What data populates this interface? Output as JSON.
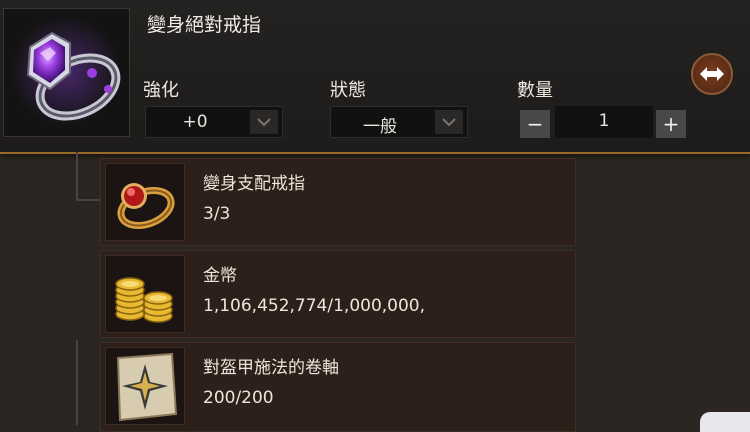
{
  "item": {
    "name": "變身絕對戒指",
    "icon": "purple-gem-ring-icon"
  },
  "controls": {
    "enhance": {
      "label": "強化",
      "value": "+0"
    },
    "status": {
      "label": "狀態",
      "value": "一般"
    },
    "quantity": {
      "label": "數量",
      "value": "1",
      "minus": "−",
      "plus": "+"
    }
  },
  "materials": [
    {
      "name": "變身支配戒指",
      "count": "3/3",
      "icon": "red-gem-ring-icon"
    },
    {
      "name": "金幣",
      "count": "1,106,452,774/1,000,000,",
      "icon": "gold-coins-icon"
    },
    {
      "name": "對盔甲施法的卷軸",
      "count": "200/200",
      "icon": "armor-scroll-icon"
    }
  ],
  "colors": {
    "accent_border": "#9a6a2a",
    "swap_button": "#6a3418",
    "material_bg": "#2d1f19"
  }
}
